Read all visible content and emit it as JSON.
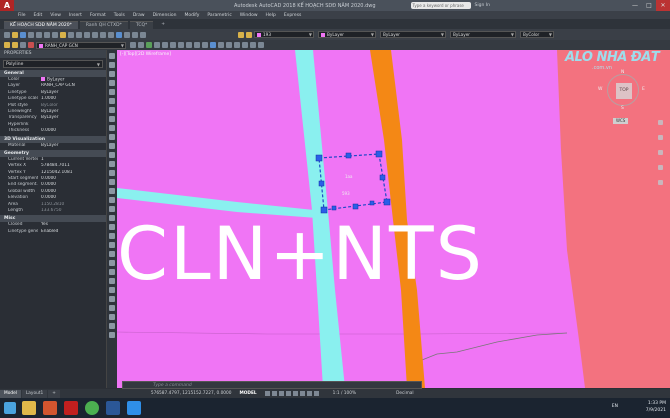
{
  "titlebar": {
    "logo": "A",
    "title": "Autodesk AutoCAD 2018   KẾ HOẠCH SDĐ NĂM 2020.dwg",
    "search_placeholder": "Type a keyword or phrase",
    "user": "Sign In",
    "minimize": "—",
    "maximize": "□",
    "close": "✕"
  },
  "menu": [
    "File",
    "Edit",
    "View",
    "Insert",
    "Format",
    "Tools",
    "Draw",
    "Dimension",
    "Modify",
    "Parametric",
    "Window",
    "Help",
    "Express"
  ],
  "tabs": [
    {
      "label": "KẾ HOẠCH SDĐ NĂM 2020*",
      "active": true
    },
    {
      "label": "Ranh QH CTXD*",
      "active": false
    },
    {
      "label": "TCQ*",
      "active": false
    },
    {
      "label": "+",
      "active": false
    }
  ],
  "toolbar": {
    "layer_name": "RANH_CAP GCN",
    "color_value": "193",
    "layer_combo": "ByLayer",
    "linetype_combo": "ByLayer",
    "lineweight_combo": "ByLayer",
    "plotstyle_combo": "ByColor"
  },
  "properties": {
    "header": "PROPERTIES",
    "object_type": "Polyline",
    "sections": [
      {
        "title": "General",
        "rows": [
          {
            "k": "Color",
            "v": "ByLayer"
          },
          {
            "k": "Layer",
            "v": "RANH_CAP GCN"
          },
          {
            "k": "Linetype",
            "v": "ByLayer"
          },
          {
            "k": "Linetype scale",
            "v": "1.0000"
          },
          {
            "k": "Plot style",
            "v": "ByColor",
            "dim": true
          },
          {
            "k": "Lineweight",
            "v": "ByLayer"
          },
          {
            "k": "Transparency",
            "v": "ByLayer"
          },
          {
            "k": "Hyperlink",
            "v": ""
          },
          {
            "k": "Thickness",
            "v": "0.0000"
          }
        ]
      },
      {
        "title": "3D Visualization",
        "rows": [
          {
            "k": "Material",
            "v": "ByLayer"
          }
        ]
      },
      {
        "title": "Geometry",
        "rows": [
          {
            "k": "Current Vertex",
            "v": "1"
          },
          {
            "k": "Vertex X",
            "v": "578484.7011"
          },
          {
            "k": "Vertex Y",
            "v": "1215042.1081"
          },
          {
            "k": "Start segment...",
            "v": "0.0000"
          },
          {
            "k": "End segment...",
            "v": "0.0000"
          },
          {
            "k": "Global width",
            "v": "0.0000"
          },
          {
            "k": "Elevation",
            "v": "0.0000"
          },
          {
            "k": "Area",
            "v": "1150.2810",
            "dim": true
          },
          {
            "k": "Length",
            "v": "133.6750",
            "dim": true
          }
        ]
      },
      {
        "title": "Misc",
        "rows": [
          {
            "k": "Closed",
            "v": "Yes"
          },
          {
            "k": "Linetype gene...",
            "v": "Enabled"
          }
        ]
      }
    ]
  },
  "canvas": {
    "view_label": "[-][Top][2D Wireframe]",
    "overlay_text": "CLN+NTS",
    "polyline_label": "1aa",
    "polyline_area": "593",
    "watermark": "ALO NHÀ ĐẤT",
    "watermark_sub": ".com.vn",
    "viewcube_face": "TOP",
    "viewcube_n": "N",
    "viewcube_s": "S",
    "viewcube_w": "W",
    "viewcube_e": "E",
    "wcs": "WCS",
    "colors": {
      "pink_parcel": "#f075f5",
      "salmon_parcel": "#f3727f",
      "road_cyan": "#8af0ef",
      "canal_orange": "#f48815",
      "boundary_blue": "#1e48c8"
    }
  },
  "command": {
    "placeholder": "Type a command"
  },
  "status": {
    "layout_tabs": [
      "Model",
      "Layout1",
      "+"
    ],
    "coords": "576587.4797, 1215152.7227, 0.0000",
    "mode": "MODEL",
    "scale": "1:1 / 100%",
    "units": "Decimal"
  },
  "taskbar": {
    "time": "1:33 PM",
    "date": "7/9/2021",
    "language": "EN",
    "apps": [
      "explorer",
      "powerpoint",
      "autocad",
      "chrome",
      "word",
      "zalo"
    ]
  }
}
